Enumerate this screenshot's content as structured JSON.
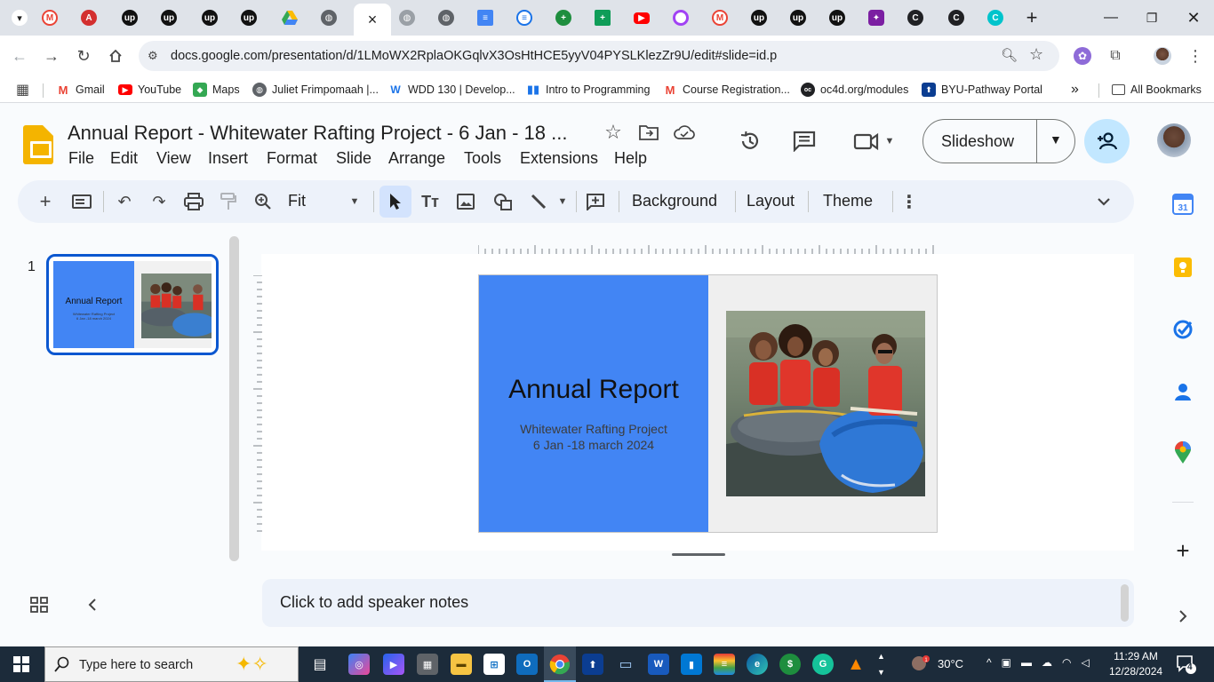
{
  "browser": {
    "url": "docs.google.com/presentation/d/1LMoWX2RplaOKGqlvX3OsHtHCE5yyV04PYSLKlezZr9U/edit#slide=id.p",
    "active_tab_close": "×",
    "new_tab": "+"
  },
  "bookmarks": [
    {
      "label": "Gmail",
      "icon": "gmail-icon",
      "color": "#ea4335"
    },
    {
      "label": "YouTube",
      "icon": "youtube-icon",
      "color": "#ff0000"
    },
    {
      "label": "Maps",
      "icon": "maps-icon",
      "color": "#34a853"
    },
    {
      "label": "Juliet Frimpomaah |...",
      "icon": "globe-icon",
      "color": "#5f6368"
    },
    {
      "label": "WDD 130 | Develop...",
      "icon": "w-icon",
      "color": "#1a73e8"
    },
    {
      "label": "Intro to Programming",
      "icon": "bars-icon",
      "color": "#1a73e8"
    },
    {
      "label": "Course Registration...",
      "icon": "gmail-icon",
      "color": "#ea4335"
    },
    {
      "label": "oc4d.org/modules",
      "icon": "oc4d-icon",
      "color": "#202124"
    },
    {
      "label": "BYU-Pathway Portal",
      "icon": "byu-icon",
      "color": "#0b3d91"
    }
  ],
  "bookmarks_more": "»",
  "all_bookmarks": "All Bookmarks",
  "doc": {
    "title": "Annual Report - Whitewater Rafting Project - 6 Jan - 18 ...",
    "menus": [
      "File",
      "Edit",
      "View",
      "Insert",
      "Format",
      "Slide",
      "Arrange",
      "Tools",
      "Extensions",
      "Help"
    ],
    "slideshow_label": "Slideshow"
  },
  "toolbar": {
    "zoom": "Fit",
    "background": "Background",
    "layout": "Layout",
    "theme": "Theme"
  },
  "filmstrip": {
    "slide_number": "1"
  },
  "slide": {
    "title": "Annual Report",
    "subtitle_line1": "Whitewater Rafting Project",
    "subtitle_line2": "6 Jan -18 march 2024",
    "colors": {
      "panel": "#4285f4",
      "background": "#efefef"
    }
  },
  "notes": {
    "placeholder": "Click to add speaker notes"
  },
  "taskbar": {
    "search_placeholder": "Type here to search",
    "temperature": "30°C",
    "time": "11:29 AM",
    "date": "12/28/2024",
    "notifications": "4"
  }
}
